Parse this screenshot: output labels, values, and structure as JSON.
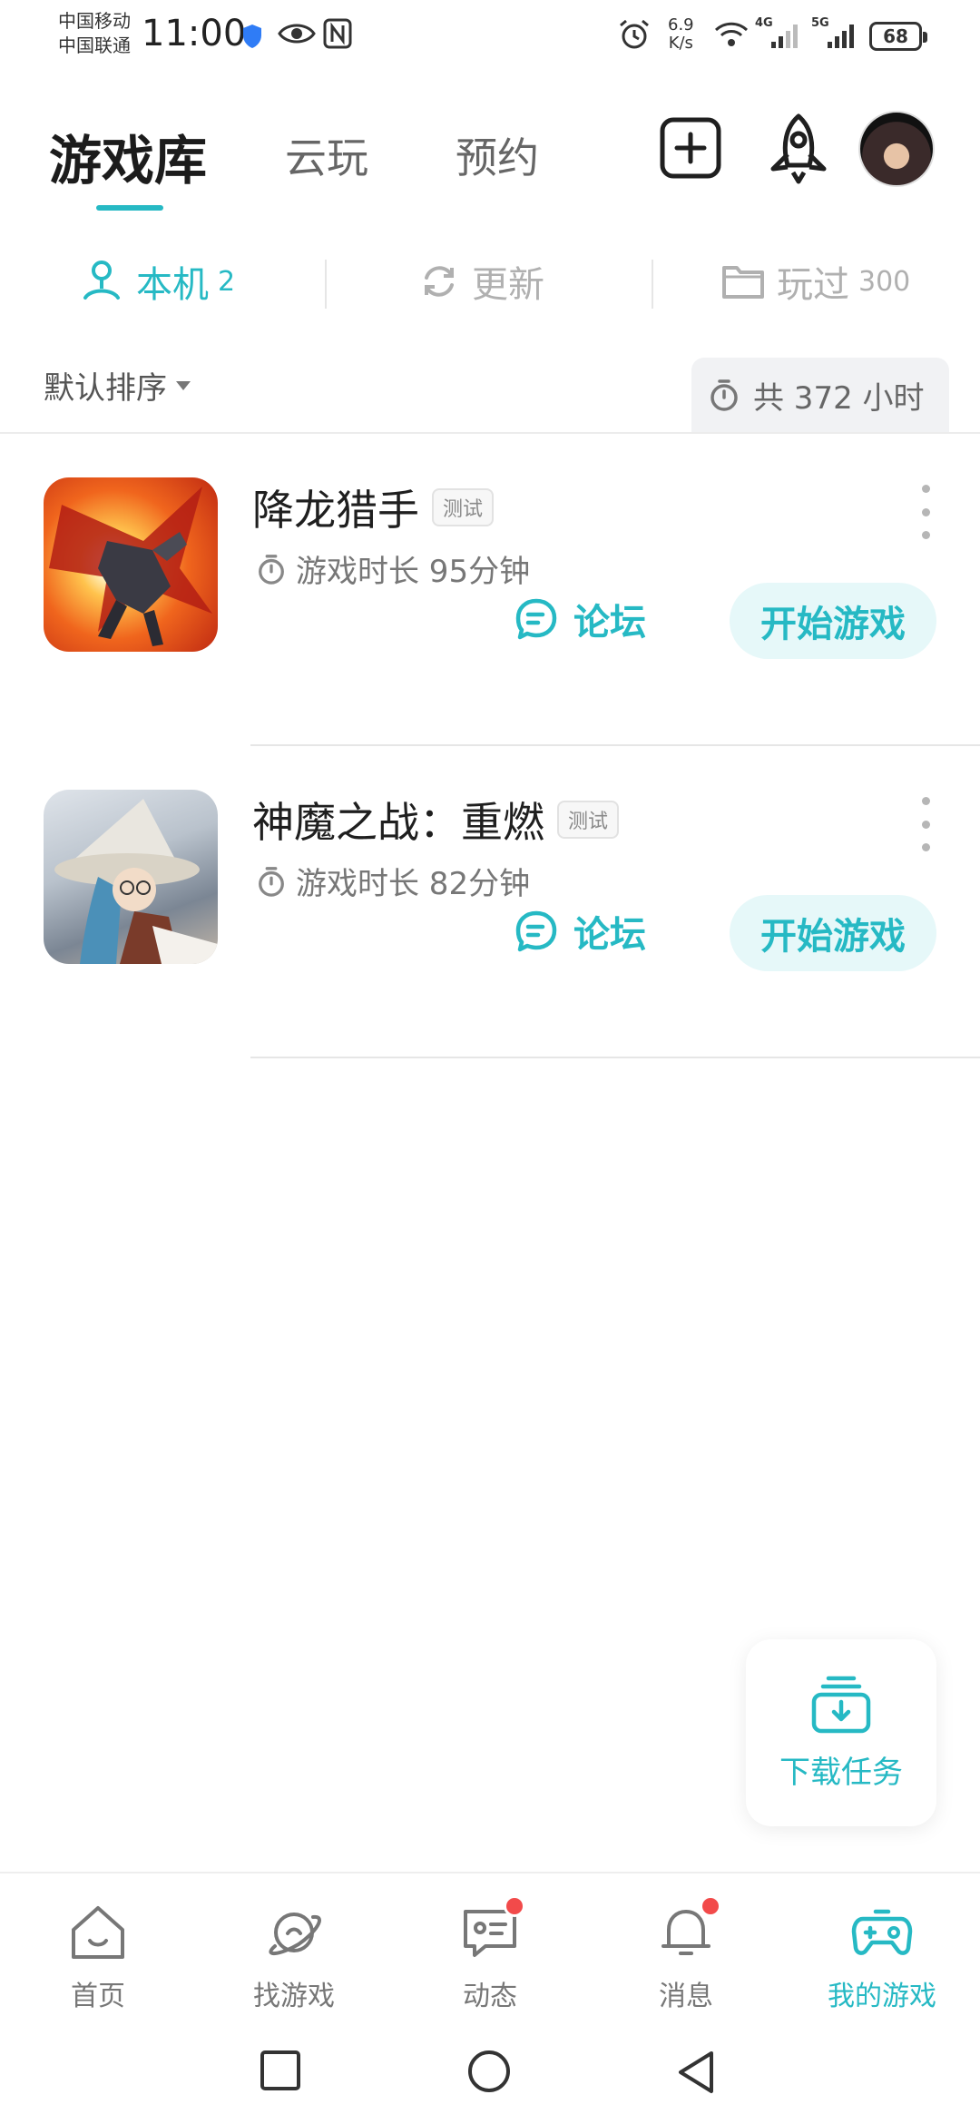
{
  "status_bar": {
    "carrier_1": "中国移动",
    "carrier_2": "中国联通",
    "time": "11:00",
    "speed_value": "6.9",
    "speed_unit": "K/s",
    "network_1": "4G",
    "network_2": "5G",
    "battery": "68"
  },
  "header": {
    "tabs": [
      {
        "label": "游戏库",
        "active": true
      },
      {
        "label": "云玩",
        "active": false
      },
      {
        "label": "预约",
        "active": false
      }
    ],
    "icons": [
      "add-square-icon",
      "rocket-icon",
      "avatar"
    ]
  },
  "filters": [
    {
      "label": "本机",
      "count": "2",
      "icon": "user-pin-icon",
      "active": true
    },
    {
      "label": "更新",
      "count": "",
      "icon": "refresh-icon",
      "active": false
    },
    {
      "label": "玩过",
      "count": "300",
      "icon": "folder-icon",
      "active": false
    }
  ],
  "sort": {
    "label": "默认排序",
    "total_playtime": "共 372 小时"
  },
  "games": [
    {
      "title": "降龙猎手",
      "tag": "测试",
      "playtime": "游戏时长 95分钟",
      "forum_label": "论坛",
      "start_label": "开始游戏"
    },
    {
      "title": "神魔之战：重燃",
      "tag": "测试",
      "playtime": "游戏时长 82分钟",
      "forum_label": "论坛",
      "start_label": "开始游戏"
    }
  ],
  "download_task": {
    "label": "下载任务"
  },
  "bottom_nav": [
    {
      "label": "首页",
      "icon": "home-icon",
      "active": false,
      "badge": false
    },
    {
      "label": "找游戏",
      "icon": "planet-icon",
      "active": false,
      "badge": false
    },
    {
      "label": "动态",
      "icon": "chat-card-icon",
      "active": false,
      "badge": true
    },
    {
      "label": "消息",
      "icon": "bell-icon",
      "active": false,
      "badge": true
    },
    {
      "label": "我的游戏",
      "icon": "gamepad-icon",
      "active": true,
      "badge": false
    }
  ],
  "colors": {
    "accent": "#26b9c4",
    "accent_light": "#e6f8f9",
    "badge_red": "#f24a4a",
    "text_dark": "#1f1f1f",
    "text_muted": "#777777"
  }
}
